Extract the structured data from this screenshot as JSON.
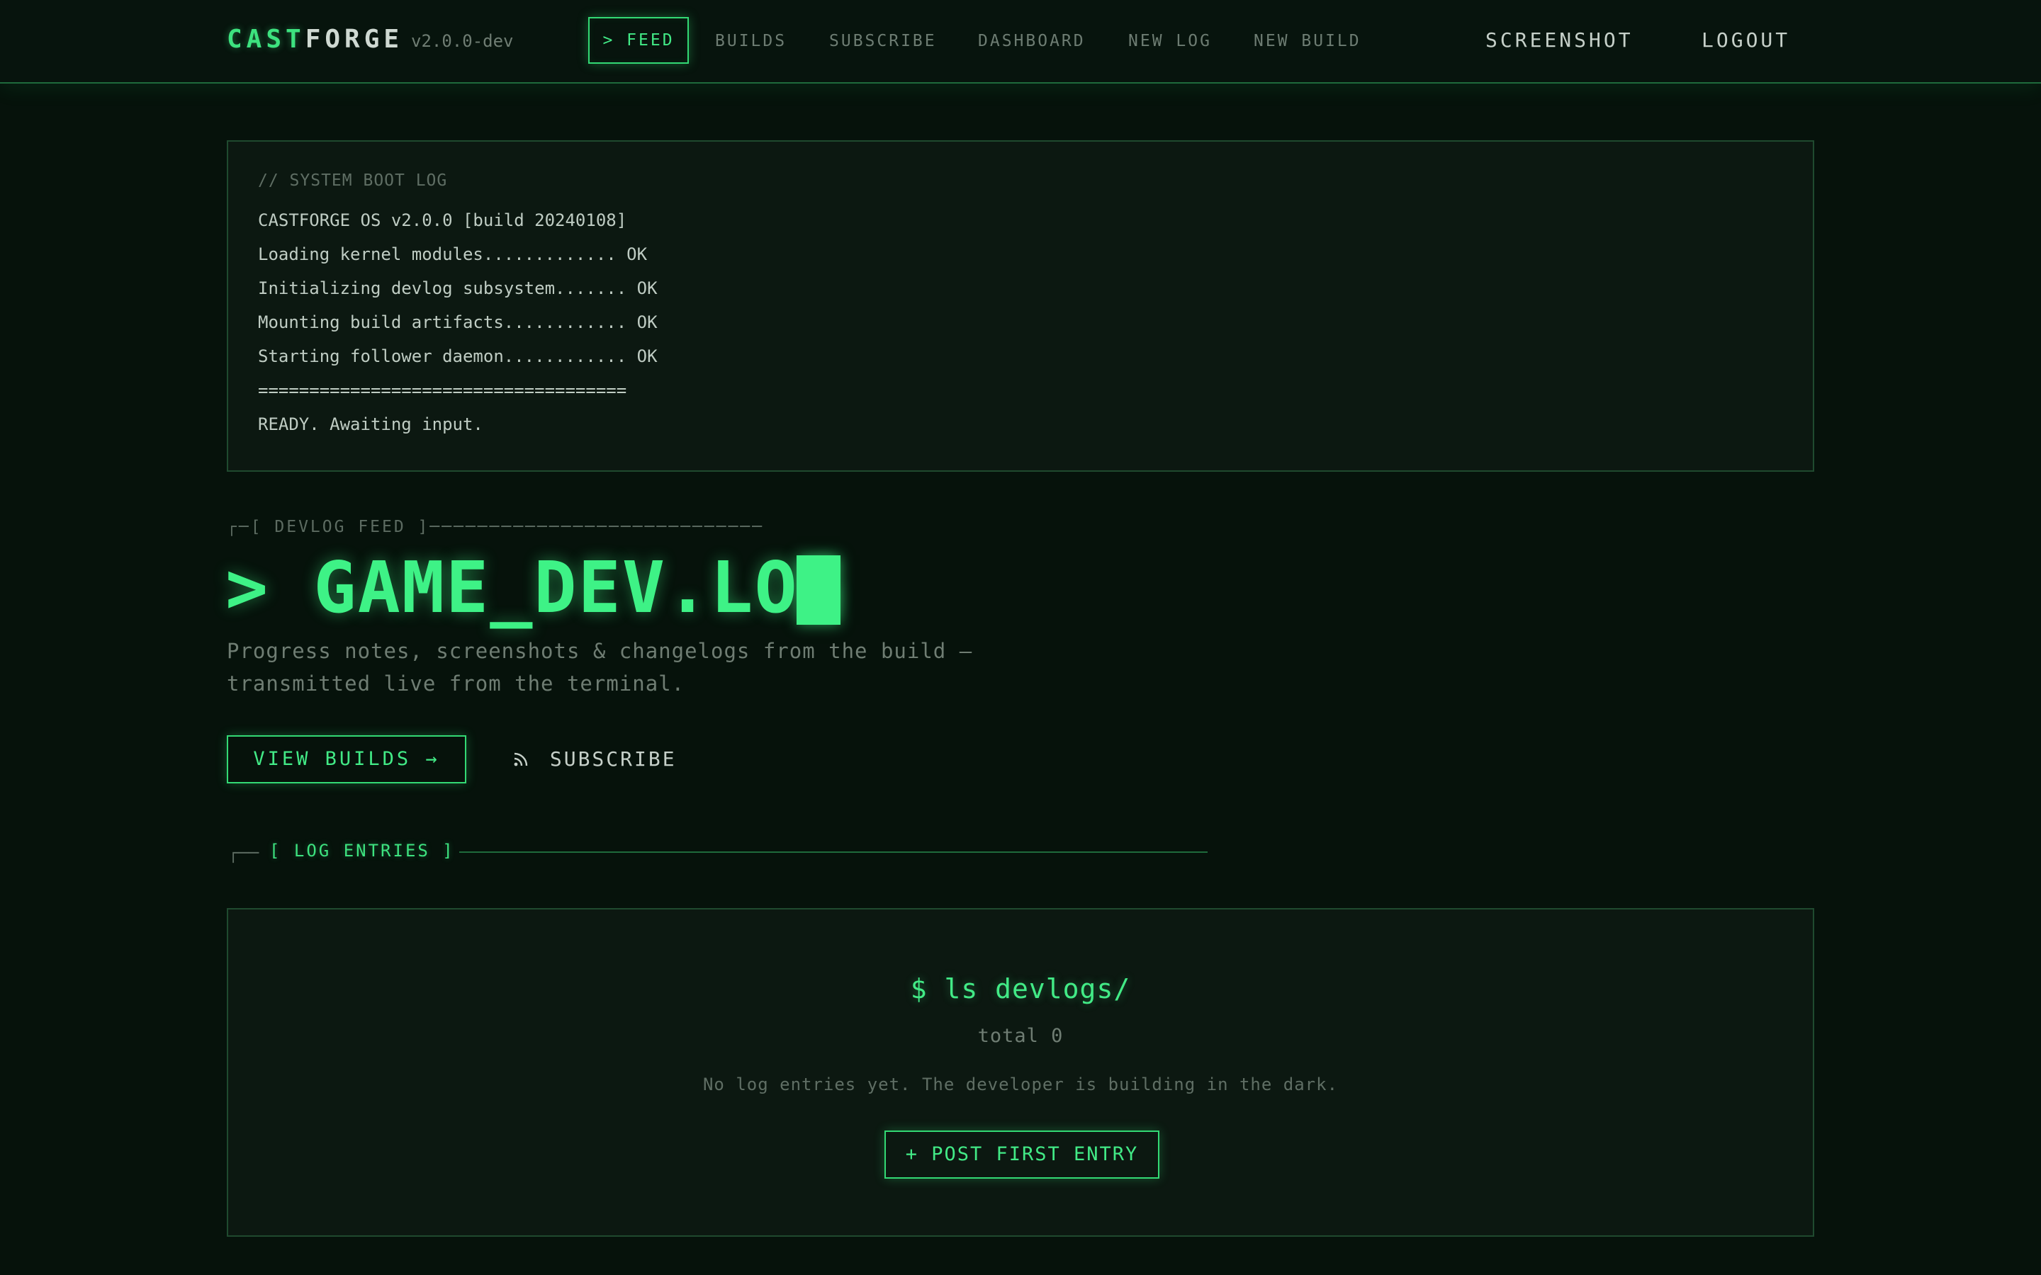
{
  "header": {
    "brand_part1": "CAST",
    "brand_part2": "FORGE",
    "version": "v2.0.0-dev",
    "nav": {
      "feed": "> FEED",
      "builds": "BUILDS",
      "subscribe": "SUBSCRIBE",
      "dashboard": "DASHBOARD",
      "new_log": "NEW LOG",
      "new_build": "NEW BUILD"
    },
    "screenshot": "SCREENSHOT",
    "logout": "LOGOUT"
  },
  "boot_log": {
    "header": "// SYSTEM BOOT LOG",
    "lines": [
      "CASTFORGE OS v2.0.0 [build 20240108]",
      "Loading kernel modules............. OK",
      "Initializing devlog subsystem....... OK",
      "Mounting build artifacts............ OK",
      "Starting follower daemon............ OK",
      "====================================",
      "READY. Awaiting input."
    ]
  },
  "hero": {
    "bracket_label": "┌─[ DEVLOG FEED ]────────────────────────────",
    "title": "> GAME_DEV.LOG",
    "description": "Progress notes, screenshots & changelogs from the build — transmitted live from the terminal.",
    "view_builds_label": "VIEW BUILDS →",
    "subscribe_label": "SUBSCRIBE"
  },
  "entries": {
    "corner": "┌──",
    "section_label": "[ LOG ENTRIES ]",
    "command": "$ ls devlogs/",
    "total": "total 0",
    "empty_message": "No log entries yet. The developer is building in the dark.",
    "post_label": "+ POST FIRST ENTRY"
  },
  "icons": {
    "subscribe": "rss-icon",
    "cursor": "block-cursor"
  },
  "colors": {
    "background": "#06120b",
    "accent": "#3ef286",
    "border": "#1f4a2f",
    "muted_text": "#6f7d73"
  }
}
